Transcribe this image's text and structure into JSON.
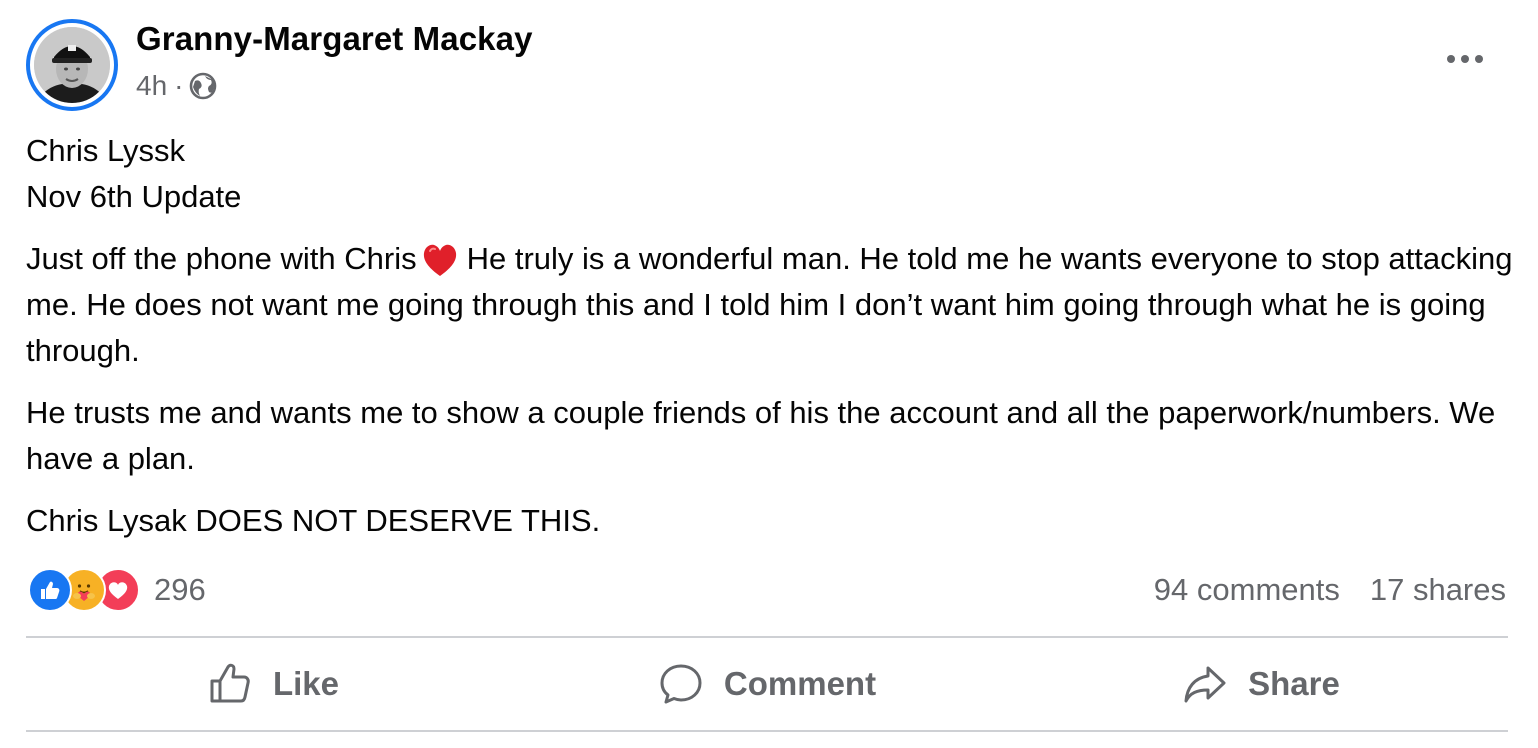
{
  "post": {
    "author": "Granny-Margaret Mackay",
    "time": "4h",
    "separator": "·",
    "privacy_icon": "globe-icon",
    "more_icon": "ellipsis-icon",
    "body": {
      "line1": "Chris Lyssk",
      "line2": "Nov 6th Update",
      "para1_before_emoji": "Just off the phone with Chris",
      "para1_emoji": "red-heart-icon",
      "para1_after_emoji": "He truly is a wonderful man. He told me he wants everyone to stop attacking me. He does not want me going through this and I told him I don’t want him going through what he is going through.",
      "para2": "He trusts me and wants me to show a couple friends of his the account and all the paperwork/numbers. We have a plan.",
      "para3": "Chris Lysak DOES NOT DESERVE THIS."
    },
    "reactions": {
      "icons": [
        "like-reaction-icon",
        "care-reaction-icon",
        "love-reaction-icon"
      ],
      "count": "296"
    },
    "stats": {
      "comments": "94 comments",
      "shares": "17 shares"
    },
    "actions": {
      "like": "Like",
      "comment": "Comment",
      "share": "Share"
    }
  },
  "colors": {
    "accent": "#1877f2",
    "secondary_text": "#65676b",
    "primary_text": "#050505",
    "love": "#f33e58",
    "care": "#f7b125",
    "divider": "#ced0d4"
  }
}
